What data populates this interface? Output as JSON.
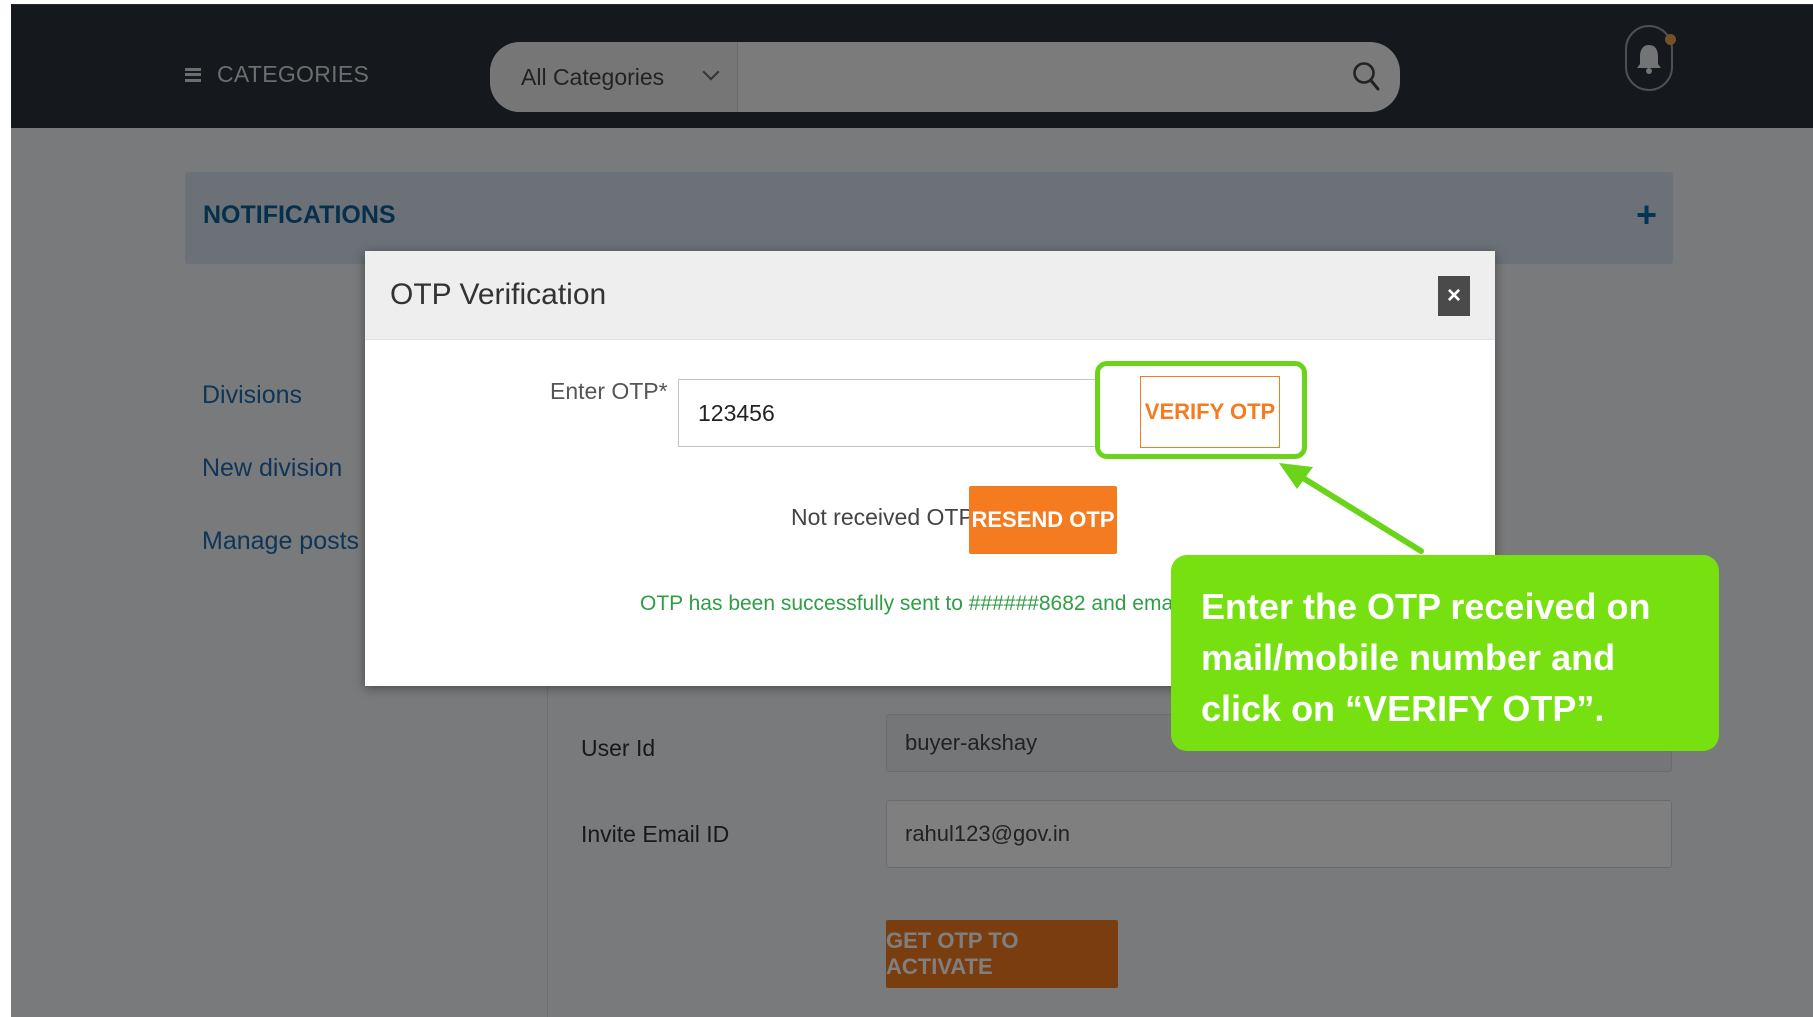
{
  "header": {
    "categories_label": "CATEGORIES",
    "search_category": "All Categories",
    "search_placeholder": ""
  },
  "notifications": {
    "title": "NOTIFICATIONS",
    "expand_symbol": "+"
  },
  "sidebar": {
    "items": [
      {
        "label": "Divisions"
      },
      {
        "label": "New division"
      },
      {
        "label": "Manage posts"
      }
    ]
  },
  "form": {
    "user_id_label": "User Id",
    "user_id_value": "buyer-akshay",
    "invite_email_label": "Invite Email ID",
    "invite_email_value": "rahul123@gov.in",
    "get_otp_button": "GET OTP TO ACTIVATE"
  },
  "modal": {
    "title": "OTP Verification",
    "close_symbol": "×",
    "otp_label": "Enter OTP*",
    "otp_value": "123456",
    "verify_button": "VERIFY OTP",
    "not_received_text": "Not received OTP?",
    "resend_button": "RESEND OTP",
    "success_message": "OTP has been successfully sent to ######8682 and email b##n@"
  },
  "callout": {
    "text": "Enter the OTP received on mail/mobile number and click on “VERIFY OTP”."
  },
  "colors": {
    "topbar": "#2b3039",
    "accent_orange": "#f47b20",
    "callout_green": "#77e011",
    "link_blue": "#1f6bae",
    "success_green": "#2f9e44"
  },
  "icons": [
    "menu-icon",
    "chevron-down-icon",
    "search-icon",
    "bell-icon",
    "close-icon",
    "plus-icon",
    "arrow-icon"
  ]
}
